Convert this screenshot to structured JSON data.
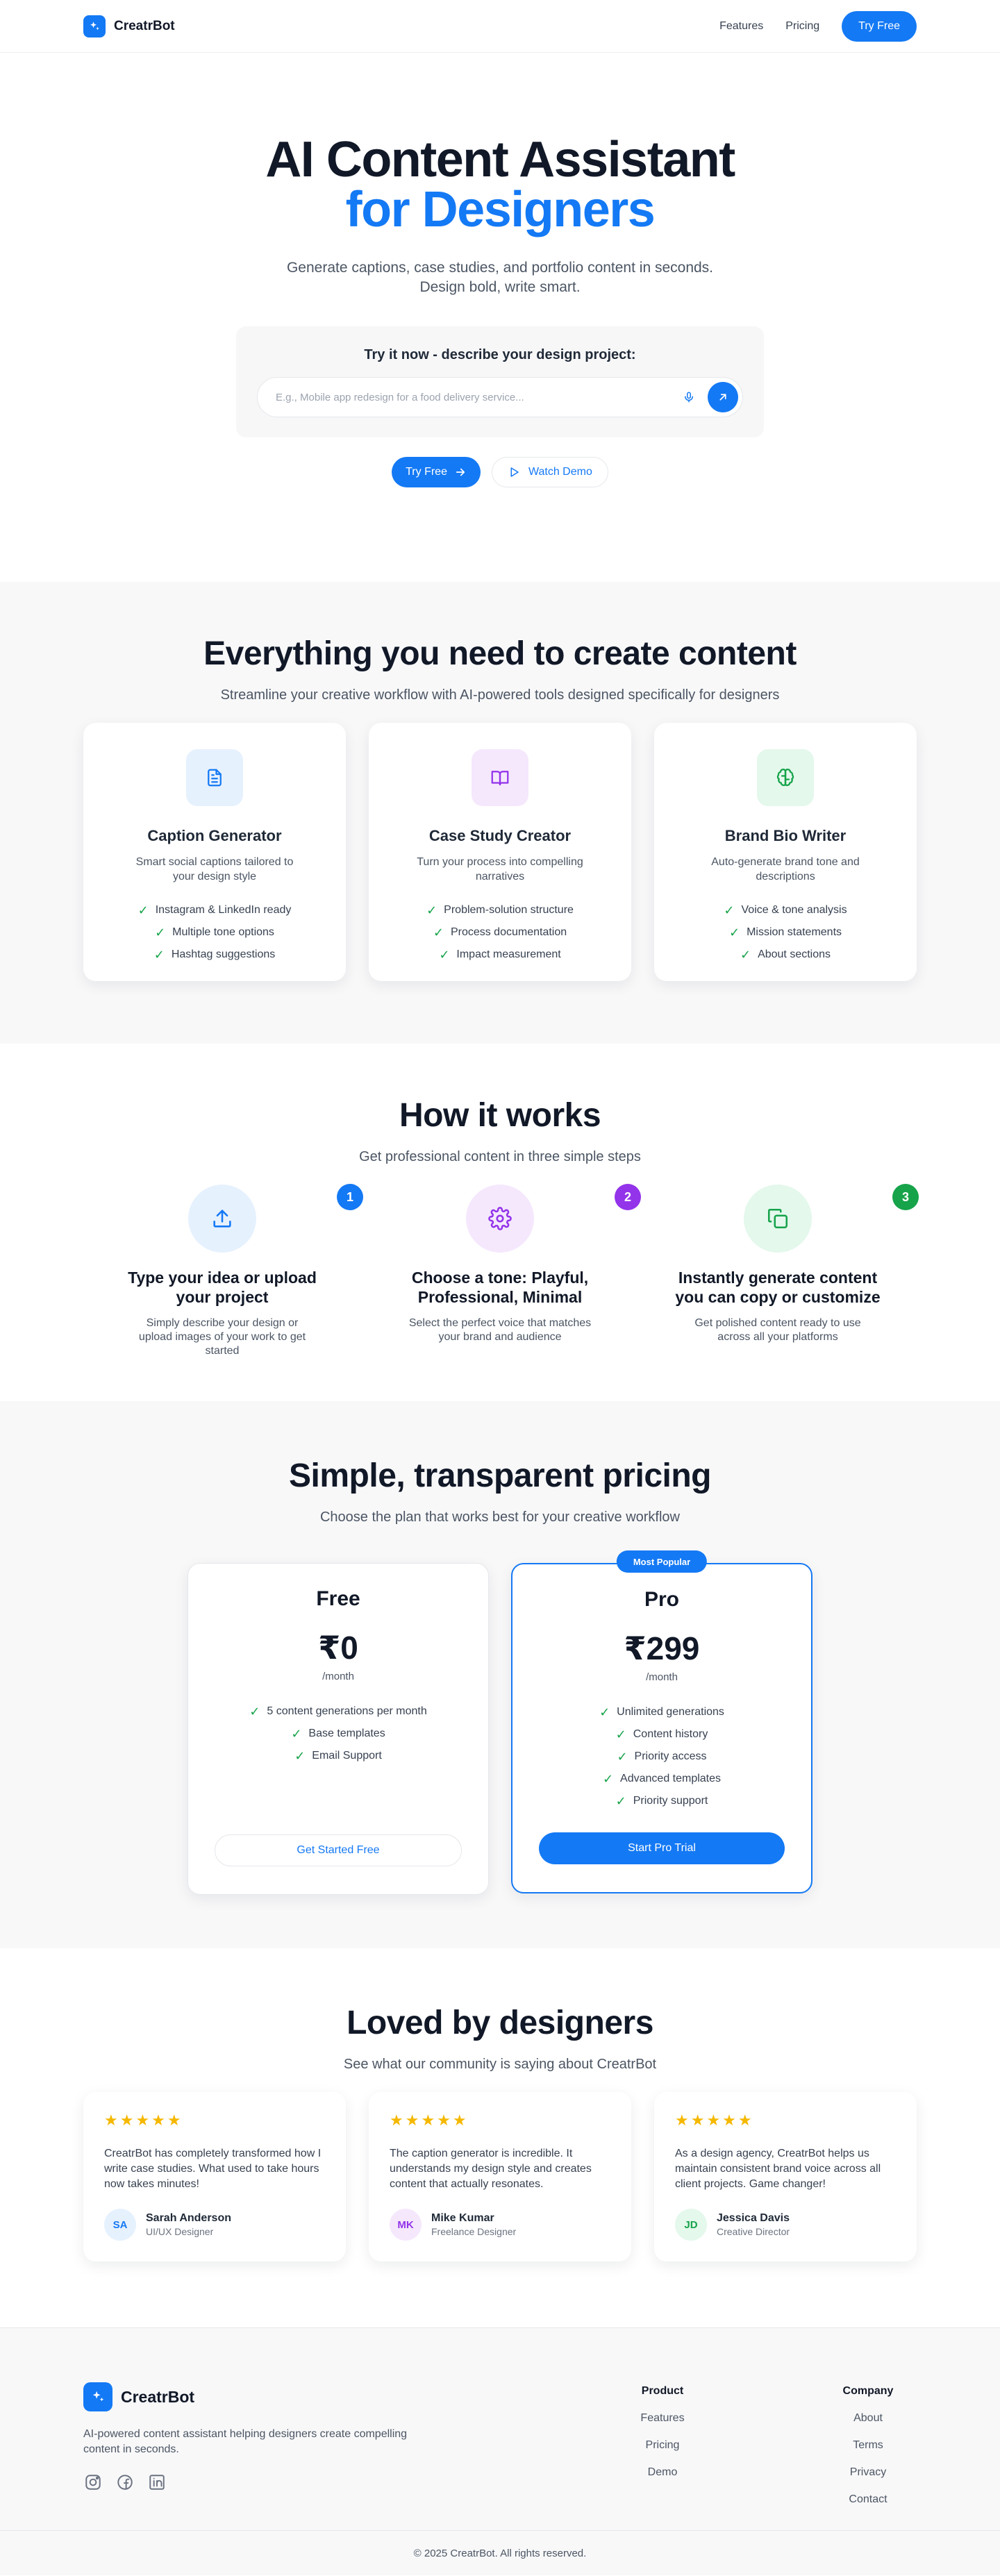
{
  "nav": {
    "brand": "CreatrBot",
    "links": [
      "Features",
      "Pricing"
    ],
    "cta": "Try Free"
  },
  "hero": {
    "title_line1": "AI Content Assistant",
    "title_line2": "for Designers",
    "subtitle_line1": "Generate captions, case studies, and portfolio content in seconds.",
    "subtitle_line2": "Design bold, write smart.",
    "try_title": "Try it now - describe your design project:",
    "input_placeholder": "E.g., Mobile app redesign for a food delivery service...",
    "cta_primary": "Try Free",
    "cta_secondary": "Watch Demo"
  },
  "features": {
    "title": "Everything you need to create content",
    "subtitle": "Streamline your creative workflow with AI-powered tools designed specifically for designers",
    "cards": [
      {
        "title": "Caption Generator",
        "desc": "Smart social captions tailored to your design style",
        "items": [
          "Instagram & LinkedIn ready",
          "Multiple tone options",
          "Hashtag suggestions"
        ],
        "icon": "document-icon",
        "tile_color": "#e6f1fe",
        "icon_color": "#1479f4"
      },
      {
        "title": "Case Study Creator",
        "desc": "Turn your process into compelling narratives",
        "items": [
          "Problem-solution structure",
          "Process documentation",
          "Impact measurement"
        ],
        "icon": "book-open-icon",
        "tile_color": "#f5e8fd",
        "icon_color": "#9333ea"
      },
      {
        "title": "Brand Bio Writer",
        "desc": "Auto-generate brand tone and descriptions",
        "items": [
          "Voice & tone analysis",
          "Mission statements",
          "About sections"
        ],
        "icon": "brain-icon",
        "tile_color": "#e4f8ec",
        "icon_color": "#16a34a"
      }
    ]
  },
  "how": {
    "title": "How it works",
    "subtitle": "Get professional content in three simple steps",
    "steps": [
      {
        "num": "1",
        "title": "Type your idea or upload your project",
        "desc": "Simply describe your design or upload images of your work to get started",
        "icon": "upload-icon",
        "bg": "#e6f1fe",
        "color": "#1479f4"
      },
      {
        "num": "2",
        "title": "Choose a tone: Playful, Professional, Minimal",
        "desc": "Select the perfect voice that matches your brand and audience",
        "icon": "settings-gear-icon",
        "bg": "#f5e8fd",
        "color": "#9333ea"
      },
      {
        "num": "3",
        "title": "Instantly generate content you can copy or customize",
        "desc": "Get polished content ready to use across all your platforms",
        "icon": "copy-icon",
        "bg": "#e4f8ec",
        "color": "#16a34a"
      }
    ]
  },
  "pricing": {
    "title": "Simple, transparent pricing",
    "subtitle": "Choose the plan that works best for your creative workflow",
    "badge": "Most Popular",
    "plans": [
      {
        "name": "Free",
        "price": "₹0",
        "period": "/month",
        "items": [
          "5 content generations per month",
          "Base templates",
          "Email Support"
        ],
        "cta": "Get Started Free"
      },
      {
        "name": "Pro",
        "price": "₹299",
        "period": "/month",
        "items": [
          "Unlimited generations",
          "Content history",
          "Priority access",
          "Advanced templates",
          "Priority support"
        ],
        "cta": "Start Pro Trial"
      }
    ]
  },
  "testimonials": {
    "title": "Loved by designers",
    "subtitle": "See what our community is saying about CreatrBot",
    "rating": 5,
    "items": [
      {
        "quote": "CreatrBot has completely transformed how I write case studies. What used to take hours now takes minutes!",
        "initials": "SA",
        "name": "Sarah Anderson",
        "role": "UI/UX Designer",
        "bg": "#e6f1fe",
        "color": "#1479f4"
      },
      {
        "quote": "The caption generator is incredible. It understands my design style and creates content that actually resonates.",
        "initials": "MK",
        "name": "Mike Kumar",
        "role": "Freelance Designer",
        "bg": "#f5e8fd",
        "color": "#9333ea"
      },
      {
        "quote": "As a design agency, CreatrBot helps us maintain consistent brand voice across all client projects. Game changer!",
        "initials": "JD",
        "name": "Jessica Davis",
        "role": "Creative Director",
        "bg": "#e4f8ec",
        "color": "#16a34a"
      }
    ]
  },
  "footer": {
    "brand": "CreatrBot",
    "desc": "AI-powered content assistant helping designers create compelling content in seconds.",
    "socials": [
      "instagram-icon",
      "facebook-icon",
      "linkedin-icon"
    ],
    "product_heading": "Product",
    "product_links": [
      "Features",
      "Pricing",
      "Demo"
    ],
    "company_heading": "Company",
    "company_links": [
      "About",
      "Terms",
      "Privacy",
      "Contact"
    ],
    "copyright": "© 2025 CreatrBot. All rights reserved."
  },
  "colors": {
    "accent": "#1479f4",
    "star": "#f5b800",
    "check": "#16a34a"
  }
}
